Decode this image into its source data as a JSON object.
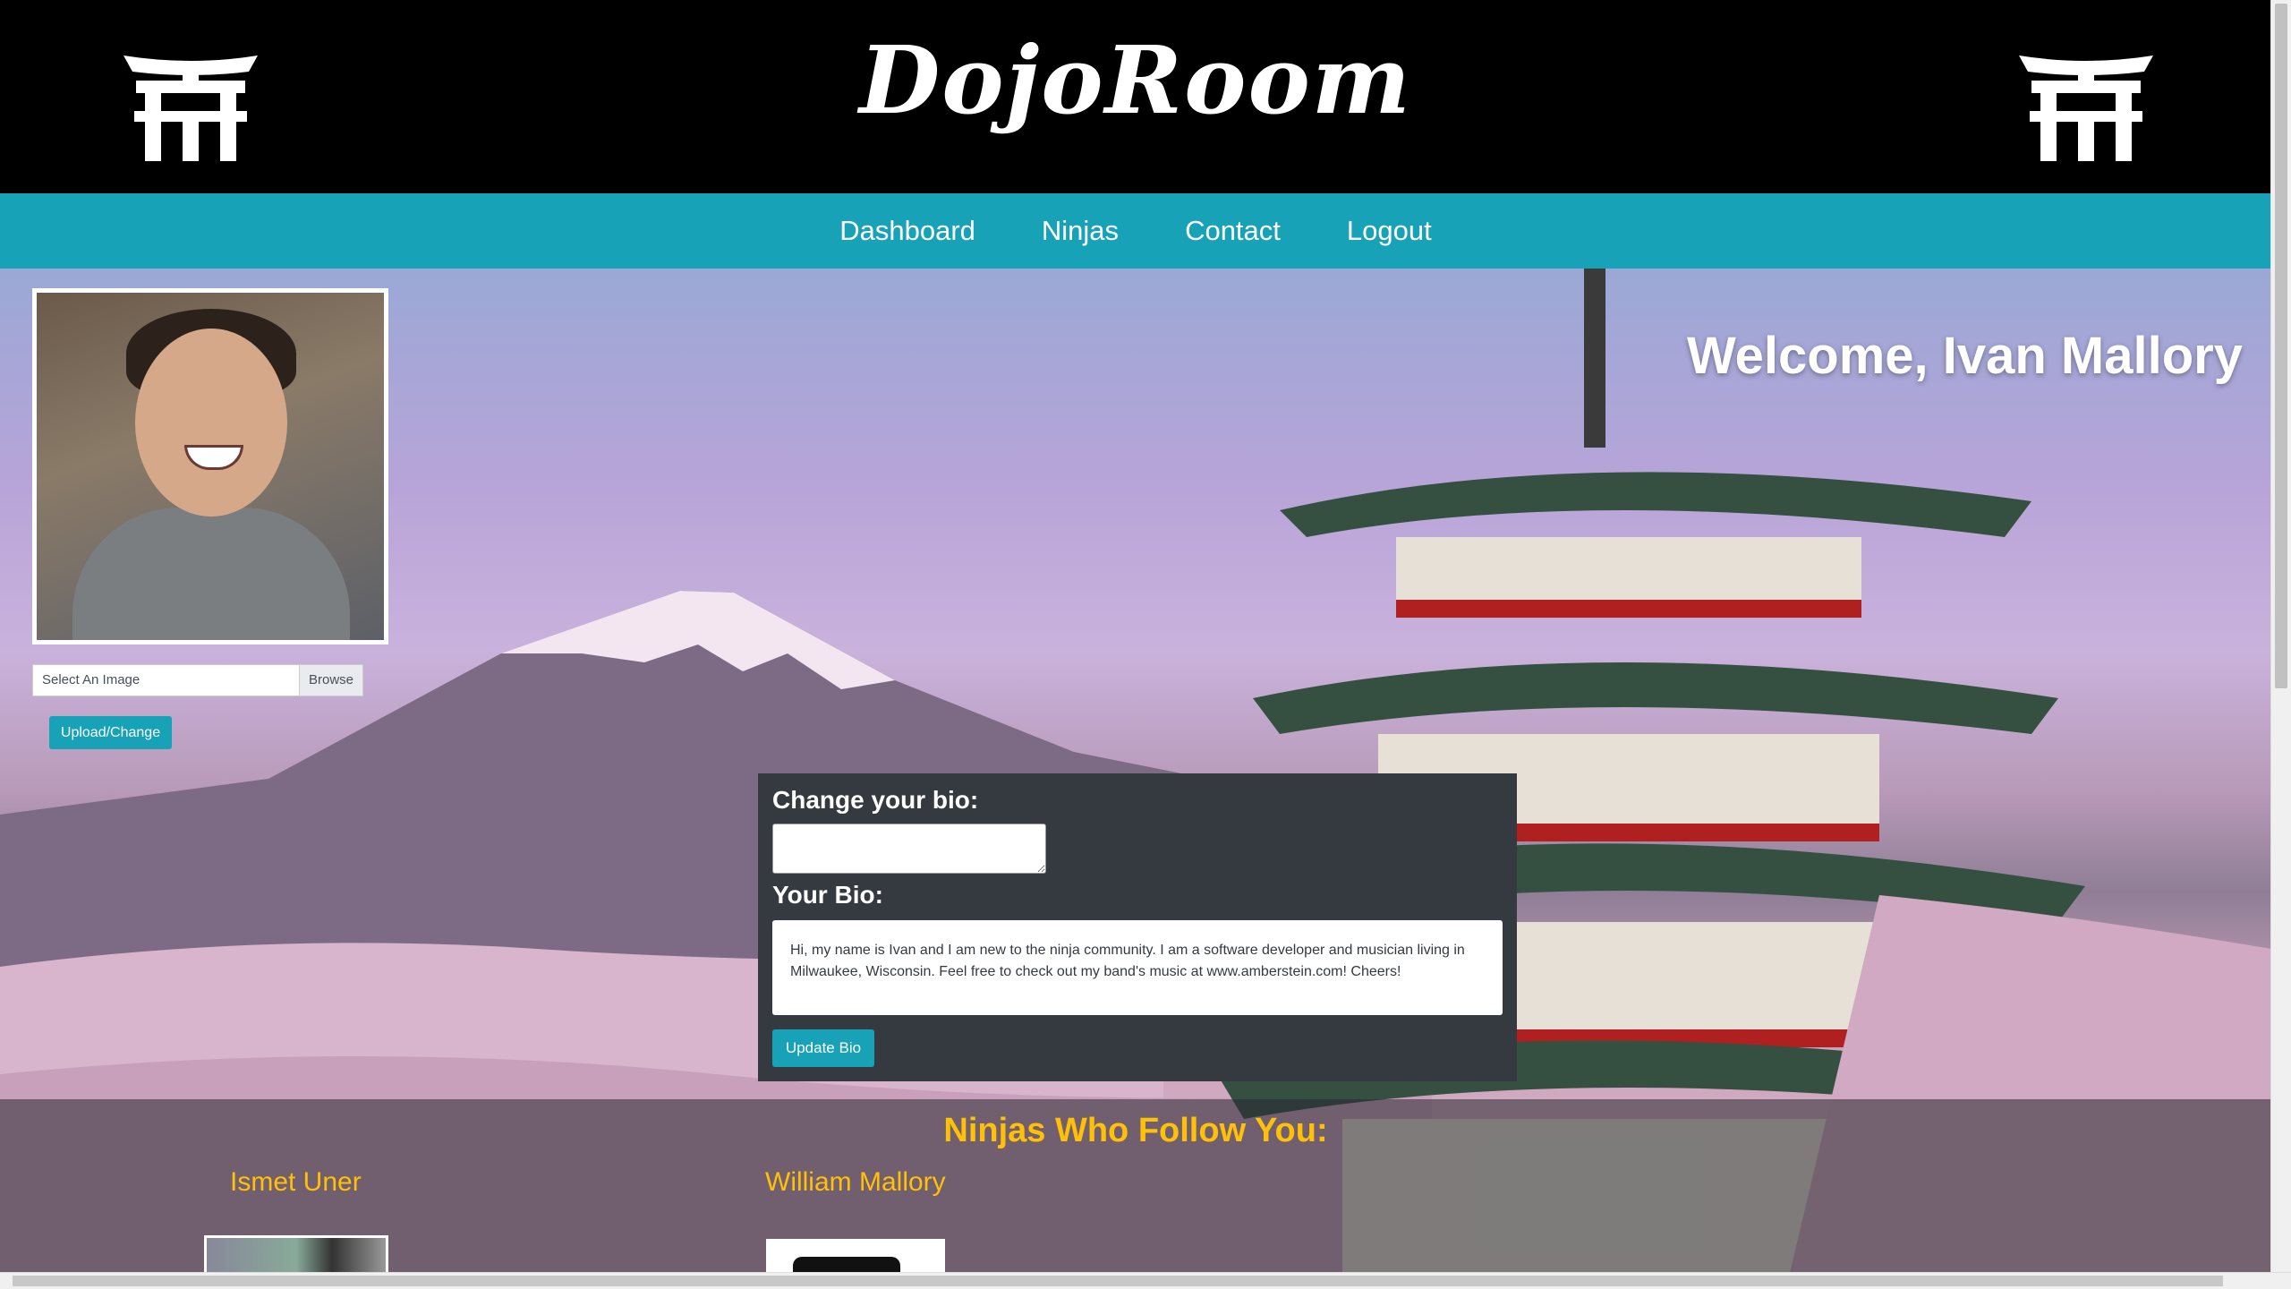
{
  "header": {
    "brand": "DojoRoom"
  },
  "nav": {
    "items": [
      "Dashboard",
      "Ninjas",
      "Contact",
      "Logout"
    ]
  },
  "profile": {
    "welcome": "Welcome, Ivan Mallory",
    "file_placeholder": "Select An Image",
    "browse_label": "Browse",
    "upload_label": "Upload/Change"
  },
  "bio": {
    "change_label": "Change your bio:",
    "your_bio_label": "Your Bio:",
    "text": "Hi, my name is Ivan and I am new to the ninja community. I am a software developer and musician living in Milwaukee, Wisconsin. Feel free to check out my band's music at www.amberstein.com! Cheers!",
    "update_label": "Update Bio"
  },
  "followers": {
    "title": "Ninjas Who Follow You:",
    "names": [
      "Ismet Uner",
      "William Mallory"
    ]
  },
  "colors": {
    "accent": "#17a2b8",
    "gold": "#ffc107",
    "panel": "#343a40"
  }
}
